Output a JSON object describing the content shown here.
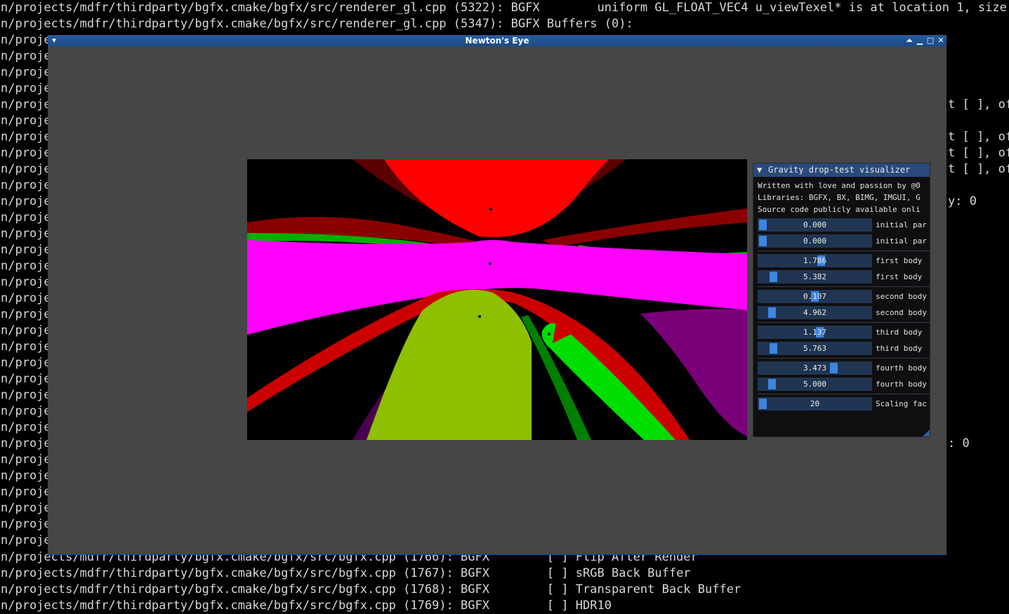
{
  "terminal": {
    "lines": [
      "n/projects/mdfr/thirdparty/bgfx.cmake/bgfx/src/renderer_gl.cpp (5322): BGFX        uniform GL_FLOAT_VEC4 u_viewTexel* is at location 1, size 1,",
      "n/projects/mdfr/thirdparty/bgfx.cmake/bgfx/src/renderer_gl.cpp (5347): BGFX Buffers (0):",
      "n/proje",
      "n/proje",
      "n/proje",
      "n/proje",
      "n/proje",
      "n/proje",
      "n/proje",
      "n/proje",
      "n/proje",
      "n/proje",
      "n/proje",
      "n/proje",
      "n/proje",
      "n/proje",
      "n/proje",
      "n/proje",
      "n/proje",
      "n/proje",
      "n/proje",
      "n/proje",
      "n/proje",
      "n/proje",
      "n/proje",
      "n/proje",
      "n/proje",
      "n/proje",
      "n/proje",
      "n/proje",
      "n/proje",
      "n/proje",
      "n/proje",
      "n/proje",
      "n/projects/mdfr/thirdparty/bgfx.cmake/bgfx/src/bgfx.cpp (1766): BGFX        [ ] Flip After Render",
      "n/projects/mdfr/thirdparty/bgfx.cmake/bgfx/src/bgfx.cpp (1767): BGFX        [ ] sRGB Back Buffer",
      "n/projects/mdfr/thirdparty/bgfx.cmake/bgfx/src/bgfx.cpp (1768): BGFX        [ ] Transparent Back Buffer",
      "n/projects/mdfr/thirdparty/bgfx.cmake/bgfx/src/bgfx.cpp (1769): BGFX        [ ] HDR10"
    ],
    "right_fragments": {
      "r150": "t [ ], of",
      "r196": "t [ ], of",
      "r219": "t [ ], of",
      "r242": "t [ ], of",
      "r288": "y: 0",
      "r633": ": 0"
    }
  },
  "window": {
    "title": "Newton's Eye",
    "menu_icon": "chevron-down-icon",
    "buttons": [
      "shade-icon",
      "minimize-icon",
      "maximize-icon",
      "close-icon"
    ]
  },
  "panel": {
    "title": "Gravity drop-test visualizer",
    "text_lines": [
      "Written with love and passion by @0",
      "Libraries: BGFX, BX, BIMG, IMGUI, G",
      "Source code publicly available onli"
    ],
    "sliders": [
      {
        "value": "0.000",
        "label": "initial par",
        "fraction": 0.0,
        "group_end": false
      },
      {
        "value": "0.000",
        "label": "initial par",
        "fraction": 0.0,
        "group_end": true
      },
      {
        "value": "1.786",
        "label": "first body",
        "fraction": 0.56,
        "group_end": false
      },
      {
        "value": "5.382",
        "label": "first body",
        "fraction": 0.1,
        "group_end": true
      },
      {
        "value": "0.107",
        "label": "second body",
        "fraction": 0.5,
        "group_end": false
      },
      {
        "value": "4.962",
        "label": "second body",
        "fraction": 0.09,
        "group_end": true
      },
      {
        "value": "1.137",
        "label": "third body",
        "fraction": 0.55,
        "group_end": false
      },
      {
        "value": "5.763",
        "label": "third body",
        "fraction": 0.1,
        "group_end": true
      },
      {
        "value": "3.473",
        "label": "fourth body",
        "fraction": 0.68,
        "group_end": false
      },
      {
        "value": "5.000",
        "label": "fourth body",
        "fraction": 0.09,
        "group_end": true
      },
      {
        "value": "20",
        "label": "Scaling fac",
        "fraction": 0.0,
        "group_end": false
      }
    ]
  },
  "colors": {
    "red": "#ff0000",
    "magenta": "#ff00ff",
    "olive": "#8ec000",
    "green": "#00dd00",
    "accent": "#3d85e0"
  }
}
